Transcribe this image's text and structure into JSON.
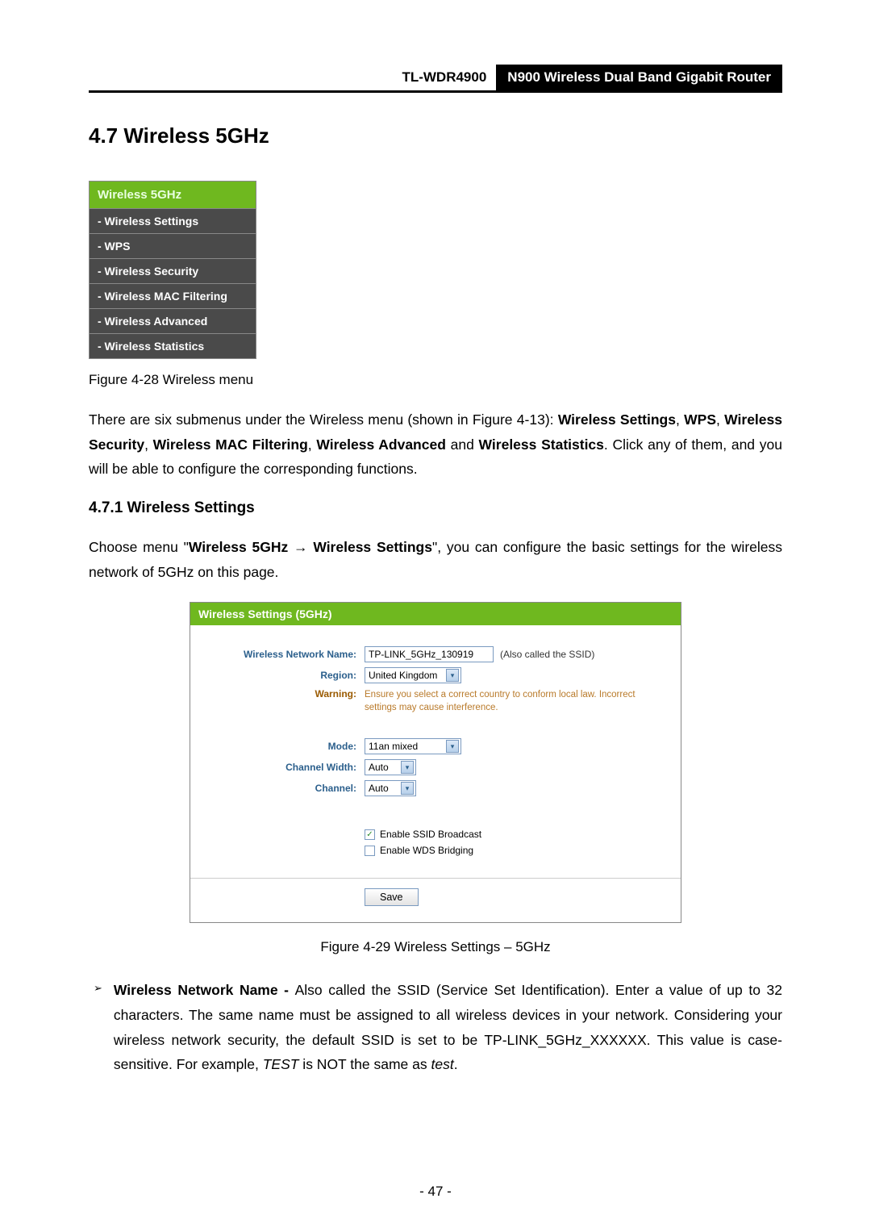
{
  "header": {
    "model": "TL-WDR4900",
    "description": "N900 Wireless Dual Band Gigabit Router"
  },
  "section": {
    "number_title": "4.7   Wireless 5GHz"
  },
  "menu": {
    "head": "Wireless 5GHz",
    "items": [
      "- Wireless Settings",
      "- WPS",
      "- Wireless Security",
      "- Wireless MAC Filtering",
      "- Wireless Advanced",
      "- Wireless Statistics"
    ]
  },
  "caption1": "Figure 4-28 Wireless menu",
  "para1": {
    "pre": "There are six submenus under the Wireless menu (shown in Figure 4-13): ",
    "b1": "Wireless Settings",
    "sep1": ", ",
    "b2": "WPS",
    "sep2": ", ",
    "b3": "Wireless Security",
    "sep3": ", ",
    "b4": "Wireless MAC Filtering",
    "sep4": ", ",
    "b5": "Wireless Advanced",
    "and": " and ",
    "b6": "Wireless Statistics",
    "post": ". Click any of them, and you will be able to configure the corresponding functions."
  },
  "subsection": {
    "number_title": "4.7.1      Wireless Settings"
  },
  "para2": {
    "pre": "Choose menu \"",
    "b1": "Wireless 5GHz",
    "arrow": "  →  ",
    "b2": "Wireless Settings",
    "post": "\", you can configure the basic settings for the wireless network of 5GHz on this page."
  },
  "panel": {
    "title": "Wireless Settings (5GHz)",
    "labels": {
      "name": "Wireless Network Name:",
      "region": "Region:",
      "warning": "Warning:",
      "mode": "Mode:",
      "width": "Channel Width:",
      "channel": "Channel:"
    },
    "values": {
      "name": "TP-LINK_5GHz_130919",
      "name_hint": "(Also called the SSID)",
      "region": "United Kingdom",
      "warning": "Ensure you select a correct country to conform local law. Incorrect settings may cause interference.",
      "mode": "11an mixed",
      "width": "Auto",
      "channel": "Auto"
    },
    "checkboxes": {
      "ssid": {
        "label": "Enable SSID Broadcast",
        "checked": true
      },
      "wds": {
        "label": "Enable WDS Bridging",
        "checked": false
      }
    },
    "save": "Save"
  },
  "caption2": "Figure 4-29 Wireless Settings – 5GHz",
  "bullet": {
    "title": "Wireless Network Name - ",
    "body_pre": "Also called the SSID (Service Set Identification). Enter a value of up to 32 characters. The same name must be assigned to all wireless devices in your network. Considering your wireless network security, the default SSID is set to be TP-LINK_5GHz_XXXXXX. This value is case-sensitive. For example, ",
    "test_upper": "TEST",
    "mid": " is NOT the same as ",
    "test_lower": "test",
    "end": "."
  },
  "page_number": "- 47 -"
}
